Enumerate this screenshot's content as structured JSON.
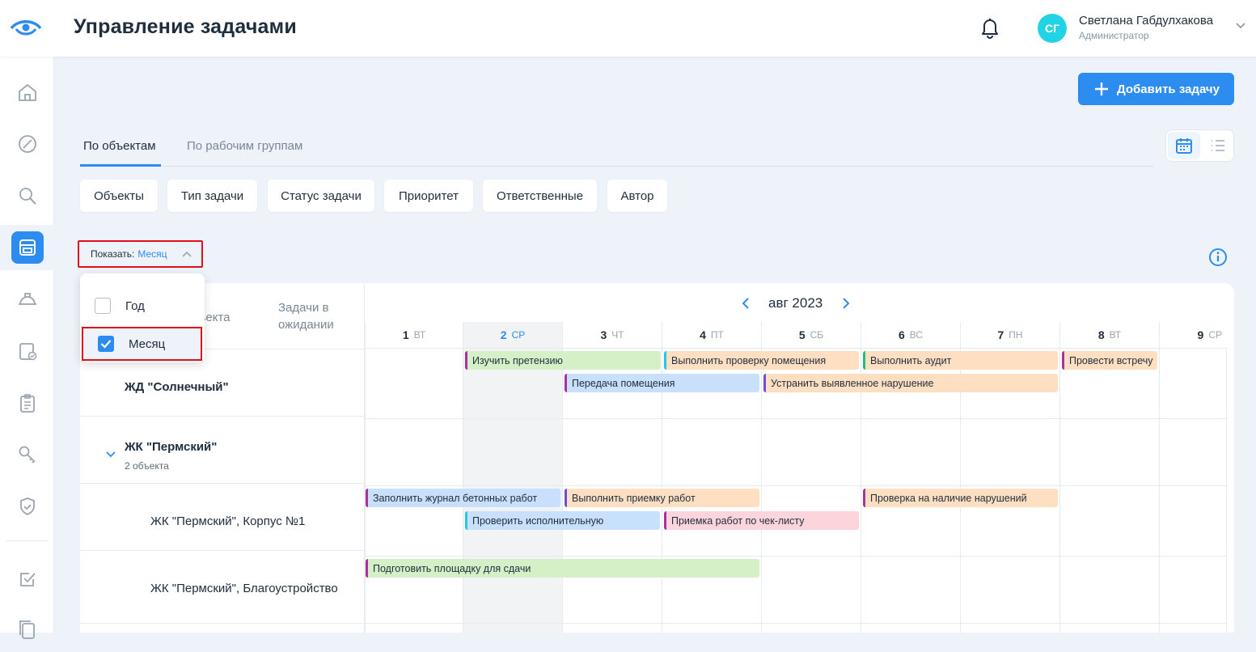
{
  "header": {
    "title": "Управление задачами",
    "user_name": "Светлана Габдулхакова",
    "user_role": "Администратор",
    "avatar_initials": "СГ"
  },
  "actions": {
    "add_task": "Добавить задачу"
  },
  "tabs": [
    {
      "label": "По объектам",
      "active": true
    },
    {
      "label": "По рабочим группам",
      "active": false
    }
  ],
  "filters": [
    "Объекты",
    "Тип задачи",
    "Статус задачи",
    "Приоритет",
    "Ответственные",
    "Автор"
  ],
  "show": {
    "label": "Показать:",
    "value": "Месяц"
  },
  "dropdown": {
    "options": [
      {
        "label": "Год",
        "checked": false
      },
      {
        "label": "Месяц",
        "checked": true
      }
    ]
  },
  "table": {
    "col_object_partial": "ъекта",
    "col_pending": "Задачи в ожидании"
  },
  "objects": [
    {
      "name": "ЖД \"Солнечный\""
    },
    {
      "name": "ЖК \"Пермский\"",
      "sub": "2 объекта"
    },
    {
      "name": "ЖК \"Пермский\", Корпус №1"
    },
    {
      "name": "ЖК \"Пермский\", Благоустройство"
    }
  ],
  "calendar": {
    "month": "авг 2023",
    "days": [
      {
        "n": "1",
        "w": "ВТ"
      },
      {
        "n": "2",
        "w": "СР",
        "today": true
      },
      {
        "n": "3",
        "w": "ЧТ"
      },
      {
        "n": "4",
        "w": "ПТ"
      },
      {
        "n": "5",
        "w": "СБ"
      },
      {
        "n": "6",
        "w": "ВС"
      },
      {
        "n": "7",
        "w": "ПН"
      },
      {
        "n": "8",
        "w": "ВТ"
      },
      {
        "n": "9",
        "w": "СР"
      }
    ],
    "tasks": [
      {
        "label": "Изучить претензию",
        "color": "green",
        "bar": "bm"
      },
      {
        "label": "Выполнить проверку помещения",
        "color": "orange",
        "bar": "bc"
      },
      {
        "label": "Выполнить аудит",
        "color": "orange",
        "bar": "bg"
      },
      {
        "label": "Провести встречу",
        "color": "orange",
        "bar": "bm"
      },
      {
        "label": "Передача помещения",
        "color": "blue",
        "bar": "bm"
      },
      {
        "label": "Устранить выявленное нарушение",
        "color": "orange",
        "bar": "bp"
      },
      {
        "label": "Заполнить журнал бетонных работ",
        "color": "blue",
        "bar": "bm"
      },
      {
        "label": "Выполнить приемку работ",
        "color": "orange",
        "bar": "bp"
      },
      {
        "label": "Проверка на наличие нарушений",
        "color": "orange",
        "bar": "bm"
      },
      {
        "label": "Проверить исполнительную",
        "color": "blue",
        "bar": "bc"
      },
      {
        "label": "Приемка работ по чек-листу",
        "color": "pink",
        "bar": "bm"
      },
      {
        "label": "Подготовить площадку для сдачи",
        "color": "green",
        "bar": "bm"
      }
    ]
  }
}
